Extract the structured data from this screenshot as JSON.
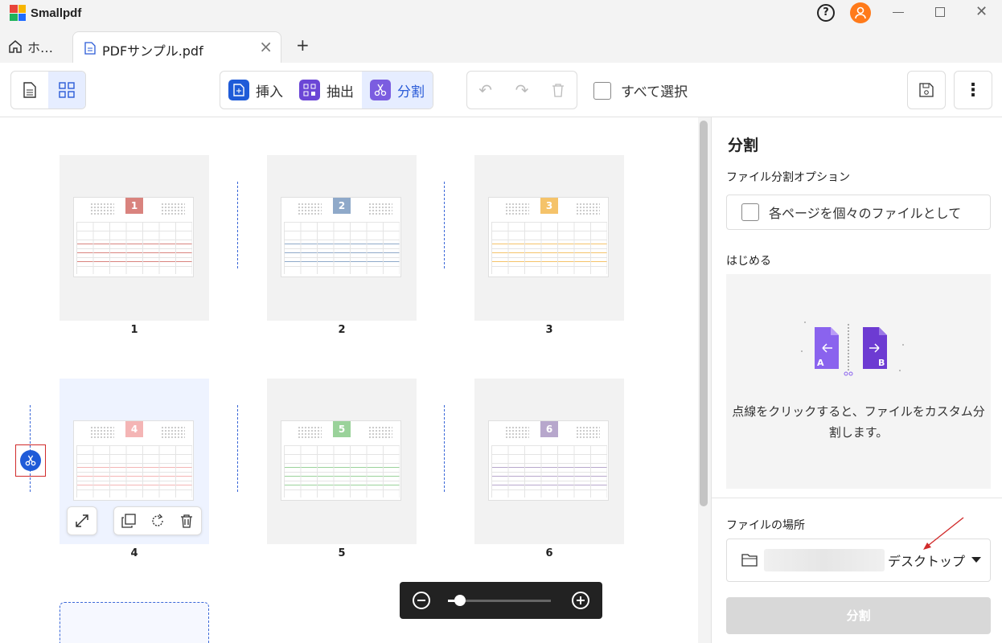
{
  "app": {
    "name": "Smallpdf"
  },
  "window": {
    "help": "?"
  },
  "tabs": {
    "home_label": "ホ…",
    "doc_label": "PDFサンプル.pdf",
    "close": "×",
    "new": "+"
  },
  "toolbar": {
    "insert": "挿入",
    "extract": "抽出",
    "split": "分割",
    "select_all": "すべて選択"
  },
  "pages": [
    {
      "label": "1",
      "num": "1",
      "color": "#d9837e"
    },
    {
      "label": "2",
      "num": "2",
      "color": "#8fa9c9"
    },
    {
      "label": "3",
      "num": "3",
      "color": "#f5c36a"
    },
    {
      "label": "4",
      "num": "4",
      "color": "#f4b5b5"
    },
    {
      "label": "5",
      "num": "5",
      "color": "#9ad29a"
    },
    {
      "label": "6",
      "num": "6",
      "color": "#b7a7cc"
    }
  ],
  "zoom": {
    "level": 0.12
  },
  "panel": {
    "title": "分割",
    "options_heading": "ファイル分割オプション",
    "option_each_page": "各ページを個々のファイルとして",
    "start_heading": "はじめる",
    "illus_a": "A",
    "illus_b": "B",
    "instructions": "点線をクリックすると、ファイルをカスタム分割します。",
    "location_heading": "ファイルの場所",
    "location_value": "デスクトップ",
    "split_button": "分割"
  },
  "colors": {
    "accent": "#1f5bd8",
    "highlight_border": "#d12b2b"
  }
}
